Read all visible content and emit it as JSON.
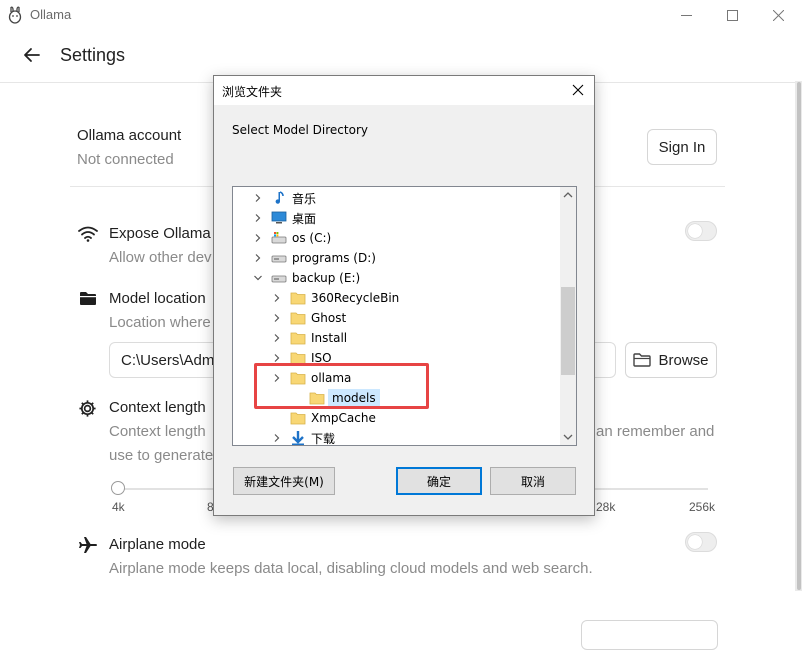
{
  "window": {
    "app_title": "Ollama",
    "minimize": "—",
    "maximize": "☐",
    "close": "✕"
  },
  "header": {
    "title": "Settings"
  },
  "account": {
    "title": "Ollama account",
    "status": "Not connected",
    "sign_in": "Sign In"
  },
  "expose": {
    "title": "Expose Ollama t",
    "desc": "Allow other dev",
    "enabled": false
  },
  "model_location": {
    "title": "Model location",
    "desc": "Location where",
    "path": "C:\\Users\\Adm",
    "browse": "Browse"
  },
  "context": {
    "title": "Context length",
    "desc_left1": "Context length",
    "desc_left2": "use to generate",
    "desc_right": "an remember and",
    "ticks_left": [
      "4k",
      "8"
    ],
    "ticks_right": [
      "28k",
      "256k"
    ],
    "value_fraction": 0
  },
  "airplane": {
    "title": "Airplane mode",
    "desc": "Airplane mode keeps data local, disabling cloud models and web search.",
    "enabled": false
  },
  "dialog": {
    "title": "浏览文件夹",
    "description": "Select Model Directory",
    "tree": [
      {
        "label": "音乐",
        "icon": "music-note-icon",
        "expanded": false,
        "indent": 0
      },
      {
        "label": "桌面",
        "icon": "desktop-icon",
        "expanded": false,
        "indent": 0
      },
      {
        "label": "os (C:)",
        "icon": "system-drive-icon",
        "expanded": false,
        "indent": 0
      },
      {
        "label": "programs (D:)",
        "icon": "drive-icon",
        "expanded": false,
        "indent": 0
      },
      {
        "label": "backup (E:)",
        "icon": "drive-icon",
        "expanded": true,
        "indent": 0
      },
      {
        "label": "360RecycleBin",
        "icon": "folder-icon",
        "expanded": false,
        "indent": 1
      },
      {
        "label": "Ghost",
        "icon": "folder-icon",
        "expanded": false,
        "indent": 1
      },
      {
        "label": "Install",
        "icon": "folder-icon",
        "expanded": false,
        "indent": 1
      },
      {
        "label": "ISO",
        "icon": "folder-icon",
        "expanded": false,
        "indent": 1
      },
      {
        "label": "ollama",
        "icon": "folder-icon",
        "expanded": false,
        "indent": 1
      },
      {
        "label": "models",
        "icon": "folder-icon",
        "expanded": null,
        "indent": 2,
        "selected": true
      },
      {
        "label": "XmpCache",
        "icon": "folder-icon",
        "expanded": null,
        "indent": 1
      },
      {
        "label": "下载",
        "icon": "download-arrow-icon",
        "expanded": false,
        "indent": 1
      }
    ],
    "new_folder": "新建文件夹(M)",
    "ok": "确定",
    "cancel": "取消"
  },
  "colors": {
    "accent": "#0078d7",
    "selection": "#cce8ff",
    "highlight_box": "#e74444",
    "folder": "#f8d775"
  }
}
